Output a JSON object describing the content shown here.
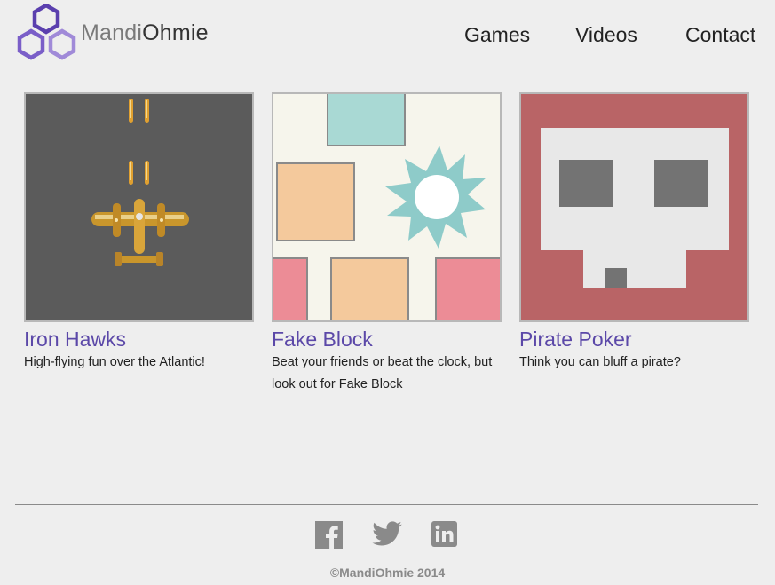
{
  "brand": {
    "part1": "Mandi",
    "part2": "Ohmie"
  },
  "nav": [
    {
      "label": "Games"
    },
    {
      "label": "Videos"
    },
    {
      "label": "Contact"
    }
  ],
  "games": [
    {
      "title": "Iron Hawks",
      "description": "High-flying fun over the Atlantic!",
      "thumbnail_icon": "plane-sprite"
    },
    {
      "title": "Fake Block",
      "description": "Beat your friends or beat the clock, but look out for Fake Block",
      "thumbnail_icon": "blocks-explosion"
    },
    {
      "title": "Pirate Poker",
      "description": "Think you can bluff a pirate?",
      "thumbnail_icon": "skull"
    }
  ],
  "social": [
    {
      "icon": "facebook-icon"
    },
    {
      "icon": "twitter-icon"
    },
    {
      "icon": "linkedin-icon"
    }
  ],
  "footer": {
    "copyright": "©MandiOhmie 2014"
  },
  "colors": {
    "background": "#eeeeee",
    "accent": "#5b48a8",
    "logo_purple": "#6a4fb8",
    "social_gray": "#8a8a8a"
  }
}
